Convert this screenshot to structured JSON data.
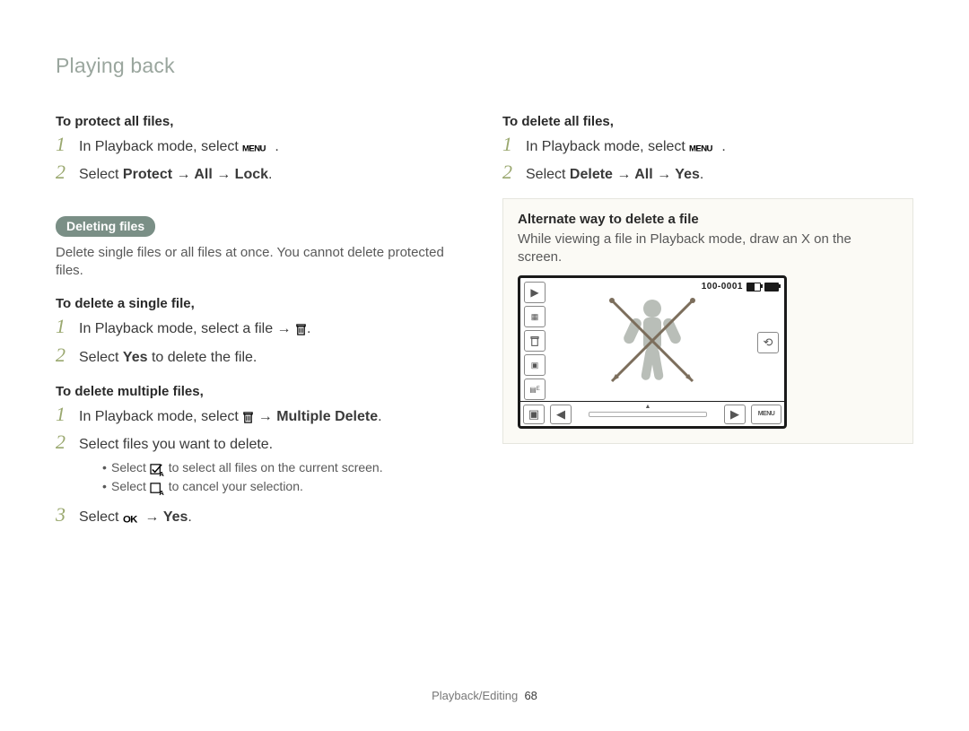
{
  "header": {
    "section_title": "Playing back"
  },
  "left": {
    "protect_all_heading": "To protect all files,",
    "protect_step1_prefix": "In Playback mode, select ",
    "protect_step2_prefix": "Select ",
    "protect_step2_path": "Protect → All → Lock",
    "deleting_pill": "Deleting files",
    "deleting_desc": "Delete single files or all files at once. You cannot delete protected files.",
    "single_heading": "To delete a single file,",
    "single_step1_prefix": "In Playback mode, select a file → ",
    "single_step2_prefix": "Select ",
    "single_step2_bold": "Yes",
    "single_step2_suffix": " to delete the file.",
    "multi_heading": "To delete multiple files,",
    "multi_step1_prefix": "In Playback mode, select ",
    "multi_step1_arrow": " → ",
    "multi_step1_bold": "Multiple Delete",
    "multi_step2": "Select files you want to delete.",
    "multi_bullet1_prefix": "Select ",
    "multi_bullet1_suffix": " to select all files on the current screen.",
    "multi_bullet2_prefix": "Select ",
    "multi_bullet2_suffix": " to cancel your selection.",
    "multi_step3_prefix": "Select ",
    "multi_step3_arrow": " → ",
    "multi_step3_bold": "Yes"
  },
  "right": {
    "delete_all_heading": "To delete all files,",
    "delete_all_step1_prefix": "In Playback mode, select ",
    "delete_all_step2_prefix": "Select ",
    "delete_all_step2_path": "Delete → All → Yes",
    "callout_heading": "Alternate way to delete a file",
    "callout_text": "While viewing a file in Playback mode, draw an X on the screen.",
    "screen_file_label": "100-0001"
  },
  "nums": {
    "n1": "1",
    "n2": "2",
    "n3": "3"
  },
  "period": ".",
  "footer": {
    "chapter": "Playback/Editing",
    "page": "68"
  }
}
